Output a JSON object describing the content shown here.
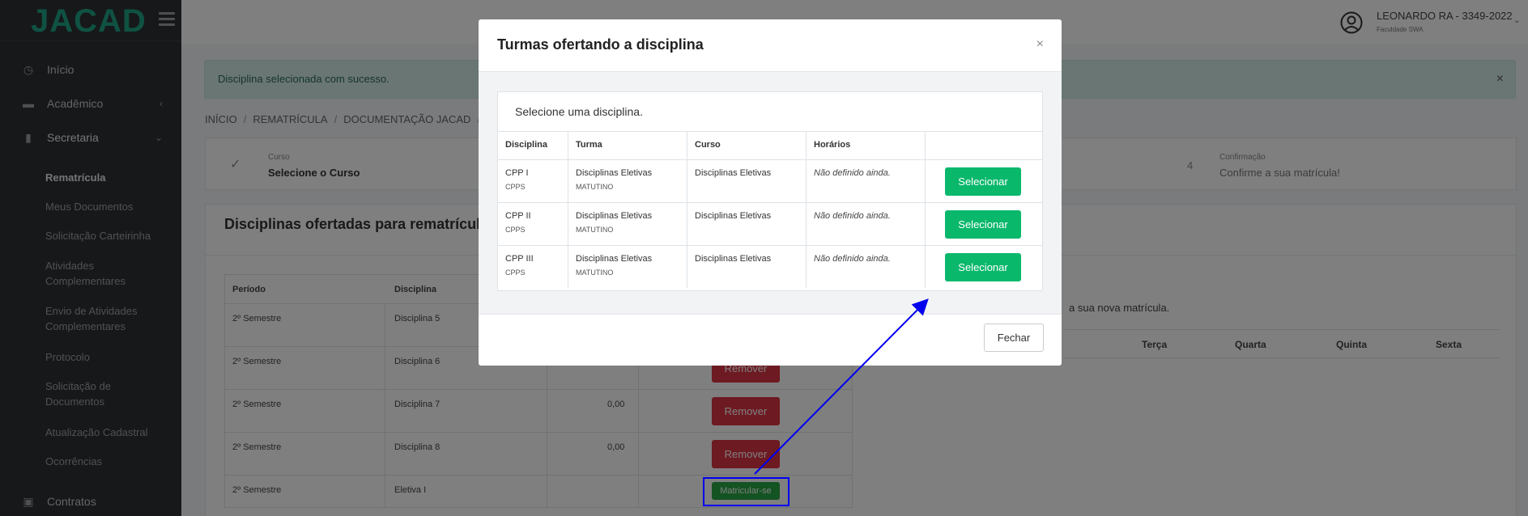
{
  "app": {
    "logo": "JACAD"
  },
  "sidebar": {
    "items": [
      {
        "label": "Início",
        "icon": "dashboard-icon"
      },
      {
        "label": "Acadêmico",
        "icon": "briefcase-icon",
        "chevron": "‹"
      },
      {
        "label": "Secretaria",
        "icon": "file-icon",
        "chevron": "⌄"
      }
    ],
    "sub_items": [
      {
        "label": "Rematrícula"
      },
      {
        "label": "Meus Documentos"
      },
      {
        "label": "Solicitação Carteirinha"
      },
      {
        "label": "Atividades Complementares"
      },
      {
        "label": "Envio de Atividades Complementares"
      },
      {
        "label": "Protocolo"
      },
      {
        "label": "Solicitação de Documentos"
      },
      {
        "label": "Atualização Cadastral"
      },
      {
        "label": "Ocorrências"
      }
    ],
    "contracts": {
      "label": "Contratos",
      "icon": "money-icon"
    }
  },
  "topbar": {
    "user_name": "LEONARDO RA - 3349-2022",
    "user_sub": "Faculdade SWA"
  },
  "alert": {
    "message": "Disciplina selecionada com sucesso.",
    "close": "×"
  },
  "breadcrumb": {
    "items": [
      "INÍCIO",
      "REMATRÍCULA",
      "DOCUMENTAÇÃO JACAD"
    ],
    "sep": "/"
  },
  "stepper": {
    "step1_small": "Curso",
    "step1_big": "Selecione o Curso",
    "step4_num": "4",
    "step4_small": "Confirmação",
    "step4_big": "Confirme a sua matrícula!"
  },
  "main": {
    "title": "Disciplinas ofertadas para rematrícula",
    "headers": {
      "periodo": "Período",
      "disciplina": "Disciplina"
    },
    "rows": [
      {
        "periodo": "2º Semestre",
        "disciplina": "Disciplina 5",
        "valor": "",
        "action": ""
      },
      {
        "periodo": "2º Semestre",
        "disciplina": "Disciplina 6",
        "valor": "",
        "action": "Remover"
      },
      {
        "periodo": "2º Semestre",
        "disciplina": "Disciplina 7",
        "valor": "0,00",
        "action": "Remover"
      },
      {
        "periodo": "2º Semestre",
        "disciplina": "Disciplina 8",
        "valor": "0,00",
        "action": "Remover"
      },
      {
        "periodo": "2º Semestre",
        "disciplina": "Eletiva I",
        "valor": "",
        "action": "Matricular-se"
      }
    ],
    "right_text": "a sua nova matrícula.",
    "days": [
      "Terça",
      "Quarta",
      "Quinta",
      "Sexta"
    ]
  },
  "modal": {
    "title": "Turmas ofertando a disciplina",
    "close": "×",
    "subtitle": "Selecione uma disciplina.",
    "headers": {
      "disciplina": "Disciplina",
      "turma": "Turma",
      "curso": "Curso",
      "horarios": "Horários"
    },
    "rows": [
      {
        "disciplina": "CPP I",
        "disc_sub": "CPPS",
        "turma": "Disciplinas Eletivas",
        "turma_sub": "MATUTINO",
        "curso": "Disciplinas Eletivas",
        "horarios": "Não definido ainda.",
        "action": "Selecionar"
      },
      {
        "disciplina": "CPP II",
        "disc_sub": "CPPS",
        "turma": "Disciplinas Eletivas",
        "turma_sub": "MATUTINO",
        "curso": "Disciplinas Eletivas",
        "horarios": "Não definido ainda.",
        "action": "Selecionar"
      },
      {
        "disciplina": "CPP III",
        "disc_sub": "CPPS",
        "turma": "Disciplinas Eletivas",
        "turma_sub": "MATUTINO",
        "curso": "Disciplinas Eletivas",
        "horarios": "Não definido ainda.",
        "action": "Selecionar"
      }
    ],
    "close_button": "Fechar"
  }
}
